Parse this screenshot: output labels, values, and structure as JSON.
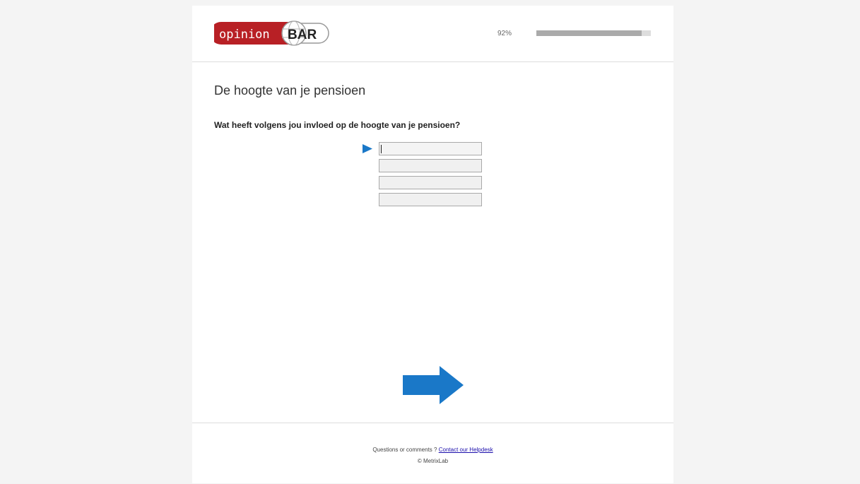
{
  "header": {
    "logo": {
      "word_left": "opinion",
      "word_right": "BAR"
    },
    "progress": {
      "label": "92%",
      "fraction": 0.92
    }
  },
  "main": {
    "page_heading": "De hoogte van je pensioen",
    "question": "Wat heeft volgens jou invloed op de hoogte van je pensioen?",
    "answers": [
      {
        "value": ""
      },
      {
        "value": ""
      },
      {
        "value": ""
      },
      {
        "value": ""
      }
    ],
    "next_button_icon": "right-arrow-icon"
  },
  "footer": {
    "question_text": "Questions or comments ?",
    "helpdesk_link": "Contact our Helpdesk",
    "copyright": "© MetrixLab"
  },
  "colors": {
    "brand_red": "#b82025",
    "accent_blue": "#1a78c8",
    "progress_fill": "#aaaaaa",
    "progress_track": "#dddddd"
  }
}
